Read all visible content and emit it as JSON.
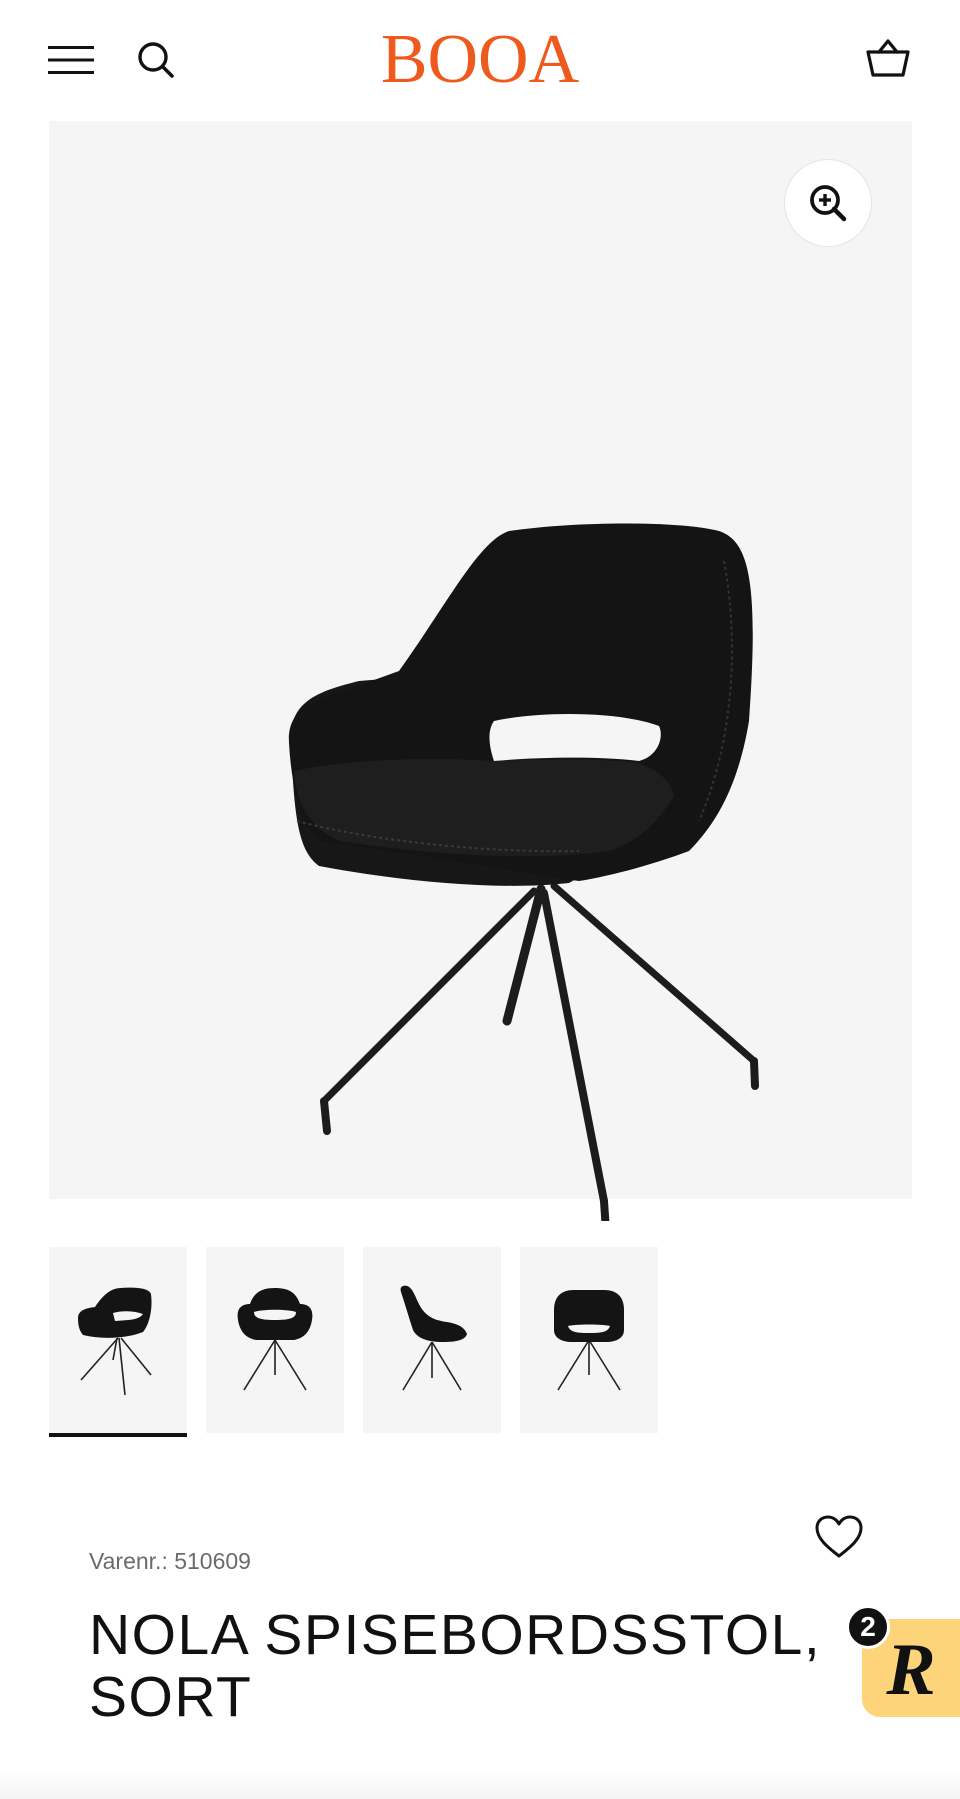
{
  "header": {
    "logo": "BOOA",
    "logo_color": "#EE5A1E",
    "icons": [
      "menu-icon",
      "search-icon",
      "basket-icon"
    ]
  },
  "gallery": {
    "zoom_icon": "zoom-in-icon",
    "thumbnails": [
      "chair-angle-view",
      "chair-front-view",
      "chair-side-view",
      "chair-back-view"
    ],
    "active_thumbnail": 0
  },
  "product": {
    "sku": "Varenr.: 510609",
    "title": "NOLA SPISEBORDSSTOL, SORT",
    "wishlist_icon": "heart-icon"
  },
  "reviews_widget": {
    "badge_count": "2",
    "letter": "R",
    "color": "#FDD47A"
  }
}
